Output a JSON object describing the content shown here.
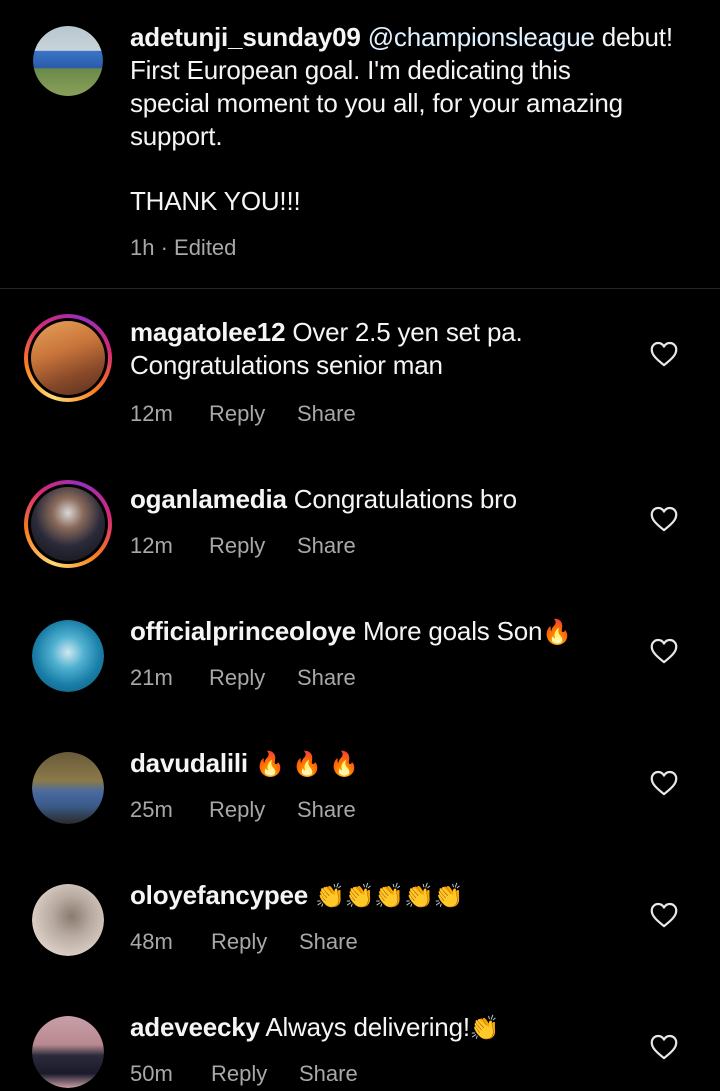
{
  "caption": {
    "username": "adetunji_sunday09",
    "mention": "@championsleague",
    "lines": [
      "debut!",
      "First European goal. I'm dedicating this",
      "special moment to you all, for your amazing",
      "support."
    ],
    "thanks": "THANK YOU!!!",
    "meta": "1h · Edited"
  },
  "comments": [
    {
      "username": "magatolee12",
      "text_line1": "Over 2.5 yen set pa.",
      "text_line2": "Congratulations senior man",
      "emoji": "",
      "time": "12m",
      "reply": "Reply",
      "share": "Share",
      "story_ring": true
    },
    {
      "username": "oganlamedia",
      "text_line1": "Congratulations bro",
      "text_line2": "",
      "emoji": "",
      "time": "12m",
      "reply": "Reply",
      "share": "Share",
      "story_ring": true
    },
    {
      "username": "officialprinceoloye",
      "text_line1": "More goals Son",
      "text_line2": "",
      "emoji": "🔥",
      "time": "21m",
      "reply": "Reply",
      "share": "Share",
      "story_ring": false
    },
    {
      "username": "davudalili",
      "text_line1": "",
      "text_line2": "",
      "emoji": "🔥 🔥 🔥",
      "time": "25m",
      "reply": "Reply",
      "share": "Share",
      "story_ring": false
    },
    {
      "username": "oloyefancypee",
      "text_line1": "",
      "text_line2": "",
      "emoji": "👏👏👏👏👏",
      "time": "48m",
      "reply": "Reply",
      "share": "Share",
      "story_ring": false
    },
    {
      "username": "adeveecky",
      "text_line1": "Always delivering!",
      "text_line2": "",
      "emoji": "👏",
      "time": "50m",
      "reply": "Reply",
      "share": "Share",
      "story_ring": false
    }
  ],
  "icons": {
    "like": "heart-outline-icon"
  },
  "colors": {
    "background": "#000000",
    "text": "#f5f5f5",
    "muted": "#a8a8a8",
    "fire": "#ff7a00",
    "clap": "#ffcc33"
  }
}
